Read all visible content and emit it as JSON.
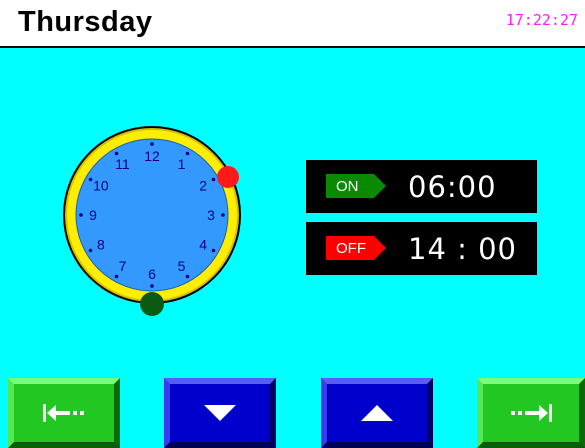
{
  "header": {
    "day": "Thursday",
    "clock": "17:22:27",
    "clock_color": "#ff20ff"
  },
  "dial": {
    "numbers": [
      "12",
      "1",
      "2",
      "3",
      "4",
      "5",
      "6",
      "7",
      "8",
      "9",
      "10",
      "11"
    ],
    "face_color": "#3399ff",
    "ring_color": "#ffee00",
    "on_marker_color": "#0a5a14",
    "off_marker_color": "#ff1a1a"
  },
  "schedule": {
    "on_label": "ON",
    "on_time": "06:00",
    "on_color": "#0a8a00",
    "off_label": "OFF",
    "off_time": "14 : 00",
    "off_color": "#ff0000"
  },
  "buttons": {
    "back_icon": "arrow-left-bar-icon",
    "down_icon": "triangle-down-icon",
    "up_icon": "triangle-up-icon",
    "next_icon": "arrow-right-bar-icon"
  },
  "colors": {
    "background": "#00ffff"
  }
}
